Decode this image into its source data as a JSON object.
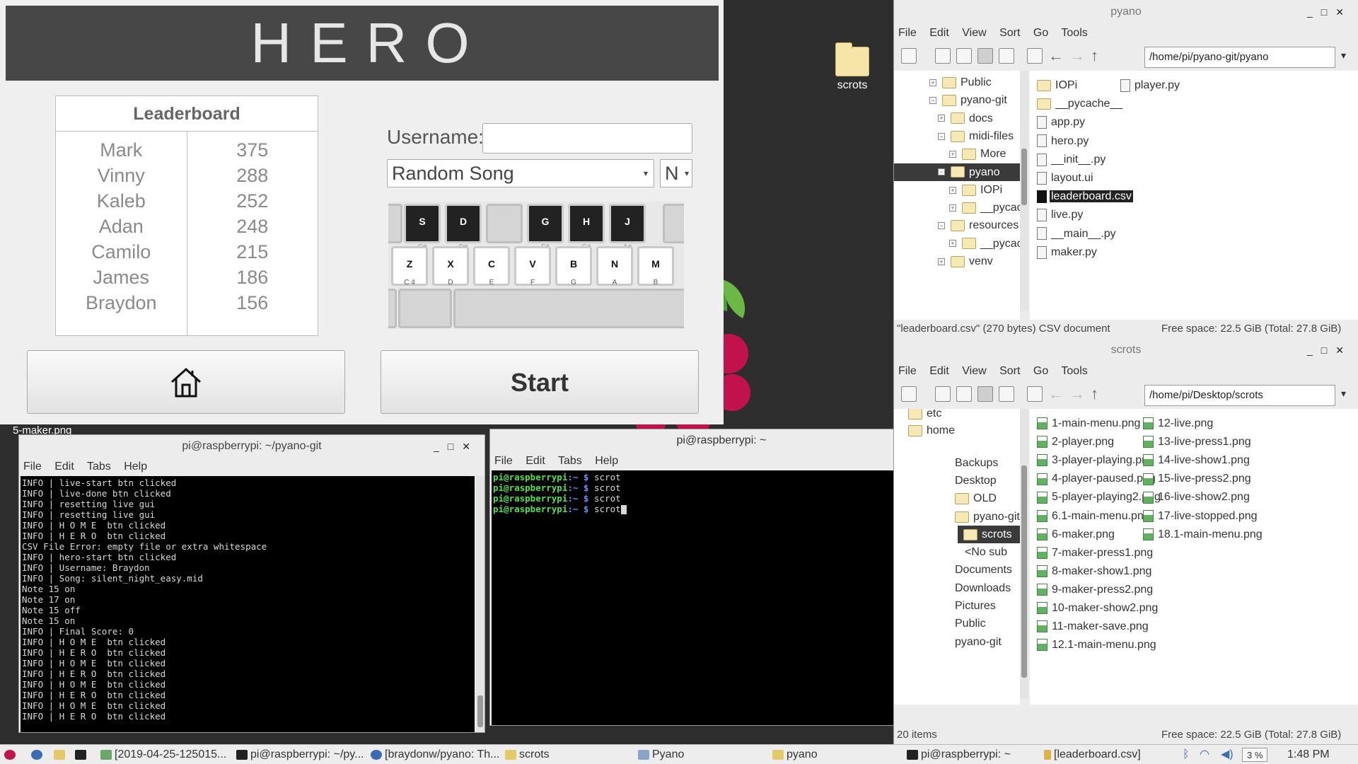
{
  "desktop": {
    "folder_label": "scrots",
    "stray_text": "5-maker.png"
  },
  "hero": {
    "title": "HERO",
    "leaderboard_title": "Leaderboard",
    "leaderboard": [
      {
        "name": "Mark",
        "score": "375"
      },
      {
        "name": "Vinny",
        "score": "288"
      },
      {
        "name": "Kaleb",
        "score": "252"
      },
      {
        "name": "Adan",
        "score": "248"
      },
      {
        "name": "Camilo",
        "score": "215"
      },
      {
        "name": "James",
        "score": "186"
      },
      {
        "name": "Braydon",
        "score": "156"
      }
    ],
    "username_label": "Username:",
    "username_value": "",
    "song_selected": "Random Song",
    "difficulty_selected": "N",
    "black_keys": [
      {
        "label": "S",
        "note": "C#"
      },
      {
        "label": "D",
        "note": "D#"
      },
      {
        "label": "G",
        "note": "F#"
      },
      {
        "label": "H",
        "note": "G#"
      },
      {
        "label": "J",
        "note": "A#"
      }
    ],
    "white_keys": [
      {
        "label": "Z",
        "note": "C 4"
      },
      {
        "label": "X",
        "note": "D"
      },
      {
        "label": "C",
        "note": "E"
      },
      {
        "label": "V",
        "note": "F"
      },
      {
        "label": "B",
        "note": "G"
      },
      {
        "label": "N",
        "note": "A"
      },
      {
        "label": "M",
        "note": "B"
      }
    ],
    "start_label": "Start",
    "home_icon": "home-icon"
  },
  "term1": {
    "title": "pi@raspberrypi: ~/pyano-git",
    "menu": [
      "File",
      "Edit",
      "Tabs",
      "Help"
    ],
    "lines": [
      "INFO | live-start btn clicked",
      "INFO | live-done btn clicked",
      "INFO | resetting live gui",
      "INFO | resetting live gui",
      "INFO | H O M E  btn clicked",
      "INFO | H E R O  btn clicked",
      "CSV File Error: empty file or extra whitespace",
      "INFO | hero-start btn clicked",
      "INFO | Username: Braydon",
      "INFO | Song: silent_night_easy.mid",
      "Note 15 on",
      "Note 17 on",
      "Note 15 off",
      "Note 15 on",
      "INFO | Final Score: 0",
      "INFO | H O M E  btn clicked",
      "INFO | H E R O  btn clicked",
      "INFO | H O M E  btn clicked",
      "INFO | H E R O  btn clicked",
      "INFO | H O M E  btn clicked",
      "INFO | H E R O  btn clicked",
      "INFO | H O M E  btn clicked",
      "INFO | H E R O  btn clicked"
    ]
  },
  "term2": {
    "title": "pi@raspberrypi: ~",
    "menu": [
      "File",
      "Edit",
      "Tabs",
      "Help"
    ],
    "prompt_user": "pi@raspberrypi",
    "prompt_path": ":~ $",
    "commands": [
      "scrot",
      "scrot",
      "scrot",
      "scrot"
    ]
  },
  "fm1": {
    "title": "pyano",
    "menu": [
      "File",
      "Edit",
      "View",
      "Sort",
      "Go",
      "Tools"
    ],
    "path": "/home/pi/pyano-git/pyano",
    "tree": [
      {
        "label": "Public",
        "expander": "+"
      },
      {
        "label": "pyano-git",
        "expander": "−"
      },
      {
        "label": "docs",
        "expander": "+"
      },
      {
        "label": "midi-files",
        "expander": "−"
      },
      {
        "label": "More",
        "expander": "+"
      },
      {
        "label": "pyano",
        "expander": "−",
        "selected": true
      },
      {
        "label": "IOPi",
        "expander": "+"
      },
      {
        "label": "__pycac",
        "expander": "+"
      },
      {
        "label": "resources",
        "expander": "−"
      },
      {
        "label": "__pycac",
        "expander": "+"
      },
      {
        "label": "venv",
        "expander": "+"
      }
    ],
    "files_col1": [
      {
        "name": "IOPi",
        "type": "folder"
      },
      {
        "name": "__pycache__",
        "type": "folder"
      },
      {
        "name": "app.py",
        "type": "doc"
      },
      {
        "name": "hero.py",
        "type": "doc"
      },
      {
        "name": "__init__.py",
        "type": "doc"
      },
      {
        "name": "layout.ui",
        "type": "doc"
      },
      {
        "name": "leaderboard.csv",
        "type": "csv",
        "selected": true
      },
      {
        "name": "live.py",
        "type": "doc"
      },
      {
        "name": "__main__.py",
        "type": "doc"
      },
      {
        "name": "maker.py",
        "type": "doc"
      }
    ],
    "files_col2": [
      {
        "name": "player.py",
        "type": "doc"
      }
    ],
    "status_left": "\"leaderboard.csv\" (270 bytes) CSV document",
    "status_right": "Free space: 22.5 GiB (Total: 27.8 GiB)"
  },
  "fm2": {
    "title": "scrots",
    "menu": [
      "File",
      "Edit",
      "View",
      "Sort",
      "Go",
      "Tools"
    ],
    "path": "/home/pi/Desktop/scrots",
    "tree": [
      {
        "label": "etc"
      },
      {
        "label": "home"
      },
      {
        "label": "Backups"
      },
      {
        "label": "Desktop"
      },
      {
        "label": "OLD"
      },
      {
        "label": "pyano-git"
      },
      {
        "label": "scrots",
        "selected": true
      },
      {
        "label": "<No sub"
      },
      {
        "label": "Documents"
      },
      {
        "label": "Downloads"
      },
      {
        "label": "Pictures"
      },
      {
        "label": "Public"
      },
      {
        "label": "pyano-git"
      }
    ],
    "files_col1": [
      "1-main-menu.png",
      "2-player.png",
      "3-player-playing.png",
      "4-player-paused.png",
      "5-player-playing2.png",
      "6.1-main-menu.png",
      "6-maker.png",
      "7-maker-press1.png",
      "8-maker-show1.png",
      "9-maker-press2.png",
      "10-maker-show2.png",
      "11-maker-save.png",
      "12.1-main-menu.png"
    ],
    "files_col2": [
      "12-live.png",
      "13-live-press1.png",
      "14-live-show1.png",
      "15-live-press2.png",
      "16-live-show2.png",
      "17-live-stopped.png",
      "18.1-main-menu.png"
    ],
    "status_left": "20 items",
    "status_right": "Free space: 22.5 GiB (Total: 27.8 GiB)"
  },
  "taskbar": {
    "items": [
      "[2019-04-25-125015...",
      "pi@raspberrypi: ~/py...",
      "[braydonw/pyano: Th...",
      "scrots",
      "Pyano",
      "pyano",
      "pi@raspberrypi: ~",
      "[leaderboard.csv]"
    ],
    "cpu": "3 %",
    "clock": "1:48 PM"
  }
}
